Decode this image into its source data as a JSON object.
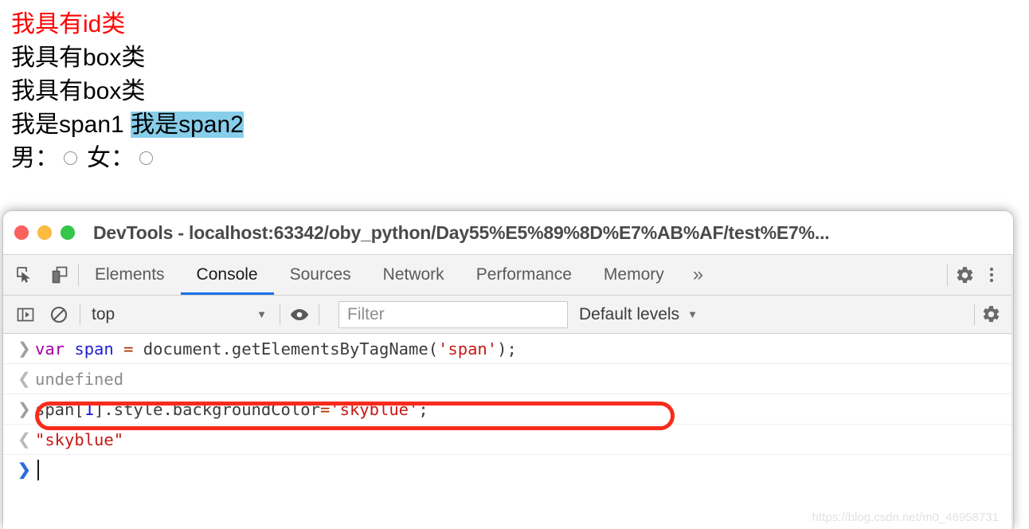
{
  "page": {
    "lines": [
      {
        "text": "我具有id类",
        "color": "#ff0000"
      },
      {
        "text": "我具有box类",
        "color": "#000000"
      },
      {
        "text": "我具有box类",
        "color": "#000000"
      }
    ],
    "span_line": {
      "span1": "我是span1",
      "space": " ",
      "span2": "我是span2",
      "span2_background": "#87ceeb"
    },
    "radio_row": {
      "male_label": "男：",
      "female_label": "女：",
      "male_checked": false,
      "female_checked": false
    }
  },
  "devtools": {
    "window_title": "DevTools - localhost:63342/oby_python/Day55%E5%89%8D%E7%AB%AF/test%E7%...",
    "traffic_lights": [
      {
        "name": "close",
        "color": "#fc615d"
      },
      {
        "name": "minimize",
        "color": "#fdbc40"
      },
      {
        "name": "maximize",
        "color": "#34c749"
      }
    ],
    "left_tools": [
      {
        "icon": "inspect-element-icon"
      },
      {
        "icon": "device-toolbar-icon"
      }
    ],
    "tabs": [
      {
        "label": "Elements",
        "active": false
      },
      {
        "label": "Console",
        "active": true
      },
      {
        "label": "Sources",
        "active": false
      },
      {
        "label": "Network",
        "active": false
      },
      {
        "label": "Performance",
        "active": false
      },
      {
        "label": "Memory",
        "active": false
      }
    ],
    "more_tabs_glyph": "»",
    "right_tools": [
      {
        "icon": "gear-icon"
      },
      {
        "icon": "more-vertical-icon"
      }
    ],
    "accent_color": "#1a73e8",
    "console_toolbar": {
      "sidebar_toggle_icon": "console-sidebar-icon",
      "clear_console_icon": "clear-console-icon",
      "context": "top",
      "context_caret": "▼",
      "eye_icon": "live-expression-eye-icon",
      "filter_placeholder": "Filter",
      "filter_value": "",
      "levels_label": "Default levels",
      "levels_caret": "▼",
      "settings_icon": "gear-icon"
    },
    "console_log": [
      {
        "kind": "input",
        "arrow": "❯",
        "highlighted": false,
        "tokens": [
          {
            "t": "var",
            "c": "kw"
          },
          {
            "t": " ",
            "c": "plain"
          },
          {
            "t": "span",
            "c": "var"
          },
          {
            "t": " ",
            "c": "plain"
          },
          {
            "t": "=",
            "c": "op"
          },
          {
            "t": " document.getElementsByTagName(",
            "c": "plain"
          },
          {
            "t": "'span'",
            "c": "str"
          },
          {
            "t": ");",
            "c": "plain"
          }
        ]
      },
      {
        "kind": "result",
        "arrow": "❮",
        "highlighted": false,
        "tokens": [
          {
            "t": "undefined",
            "c": "undef"
          }
        ]
      },
      {
        "kind": "input",
        "arrow": "❯",
        "highlighted": true,
        "tokens": [
          {
            "t": "span[",
            "c": "plain"
          },
          {
            "t": "1",
            "c": "num"
          },
          {
            "t": "].style.backgroundColor",
            "c": "plain"
          },
          {
            "t": "=",
            "c": "op"
          },
          {
            "t": "'skyblue'",
            "c": "str"
          },
          {
            "t": ";",
            "c": "plain"
          }
        ]
      },
      {
        "kind": "result",
        "arrow": "❮",
        "highlighted": false,
        "tokens": [
          {
            "t": "\"skyblue\"",
            "c": "rstr"
          }
        ]
      },
      {
        "kind": "prompt",
        "arrow": "❯",
        "highlighted": false,
        "tokens": []
      }
    ],
    "annotation": {
      "shape": "rounded-rectangle",
      "color": "#f92b1c",
      "target": "span[1].style.backgroundColor='skyblue';"
    }
  },
  "watermark": "https://blog.csdn.net/m0_46958731"
}
